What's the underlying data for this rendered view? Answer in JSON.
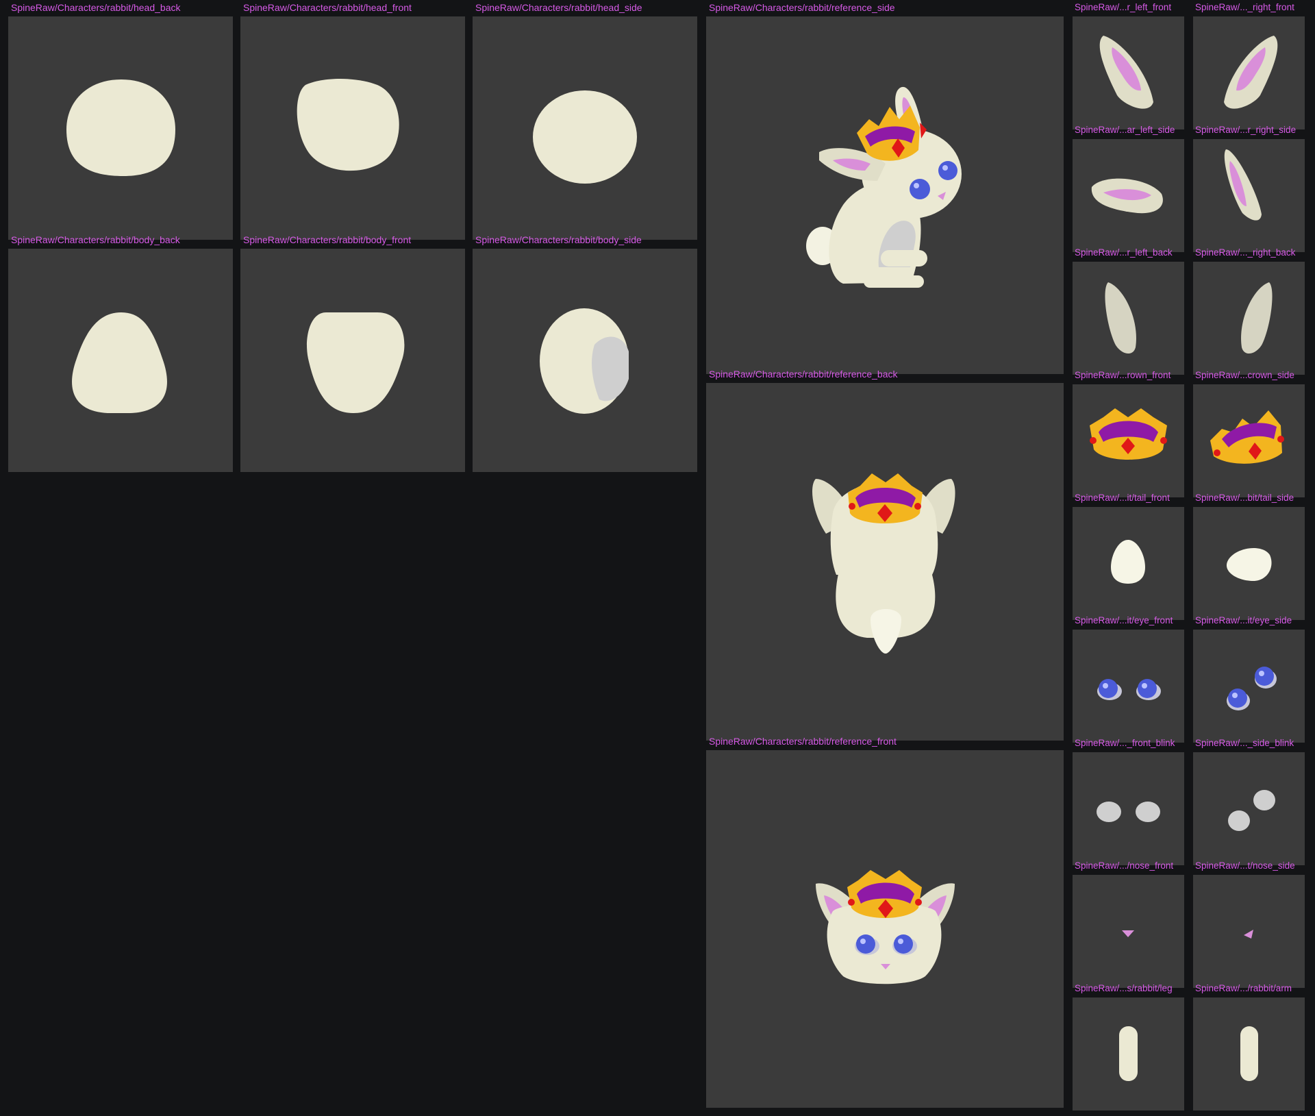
{
  "colors": {
    "background": "#131416",
    "panel": "#3b3b3b",
    "label": "#d65ae6",
    "fur": "#ebe9d3",
    "fur_shadow": "#d6d4c2",
    "gray_part": "#cfcfcf",
    "inner_ear": "#d98fd9",
    "crown_gold": "#f3b51f",
    "crown_purple": "#8f1aa6",
    "gem_red": "#e01818",
    "eye_blue": "#4b5bd8"
  },
  "sprites": {
    "head_back": "SpineRaw/Characters/rabbit/head_back",
    "head_front": "SpineRaw/Characters/rabbit/head_front",
    "head_side": "SpineRaw/Characters/rabbit/head_side",
    "body_back": "SpineRaw/Characters/rabbit/body_back",
    "body_front": "SpineRaw/Characters/rabbit/body_front",
    "body_side": "SpineRaw/Characters/rabbit/body_side",
    "reference_side": "SpineRaw/Characters/rabbit/reference_side",
    "reference_back": "SpineRaw/Characters/rabbit/reference_back",
    "reference_front": "SpineRaw/Characters/rabbit/reference_front",
    "ear_left_front": "SpineRaw/...r_left_front",
    "ear_right_front": "SpineRaw/..._right_front",
    "ear_left_side": "SpineRaw/...ar_left_side",
    "ear_right_side": "SpineRaw/...r_right_side",
    "ear_left_back": "SpineRaw/...r_left_back",
    "ear_right_back": "SpineRaw/..._right_back",
    "crown_front": "SpineRaw/...rown_front",
    "crown_side": "SpineRaw/...crown_side",
    "tail_front": "SpineRaw/...it/tail_front",
    "tail_side": "SpineRaw/...bit/tail_side",
    "eye_front": "SpineRaw/...it/eye_front",
    "eye_side": "SpineRaw/...it/eye_side",
    "eye_front_blink": "SpineRaw/..._front_blink",
    "eye_side_blink": "SpineRaw/..._side_blink",
    "nose_front": "SpineRaw/.../nose_front",
    "nose_side": "SpineRaw/...t/nose_side",
    "leg": "SpineRaw/...s/rabbit/leg",
    "arm": "SpineRaw/.../rabbit/arm"
  }
}
